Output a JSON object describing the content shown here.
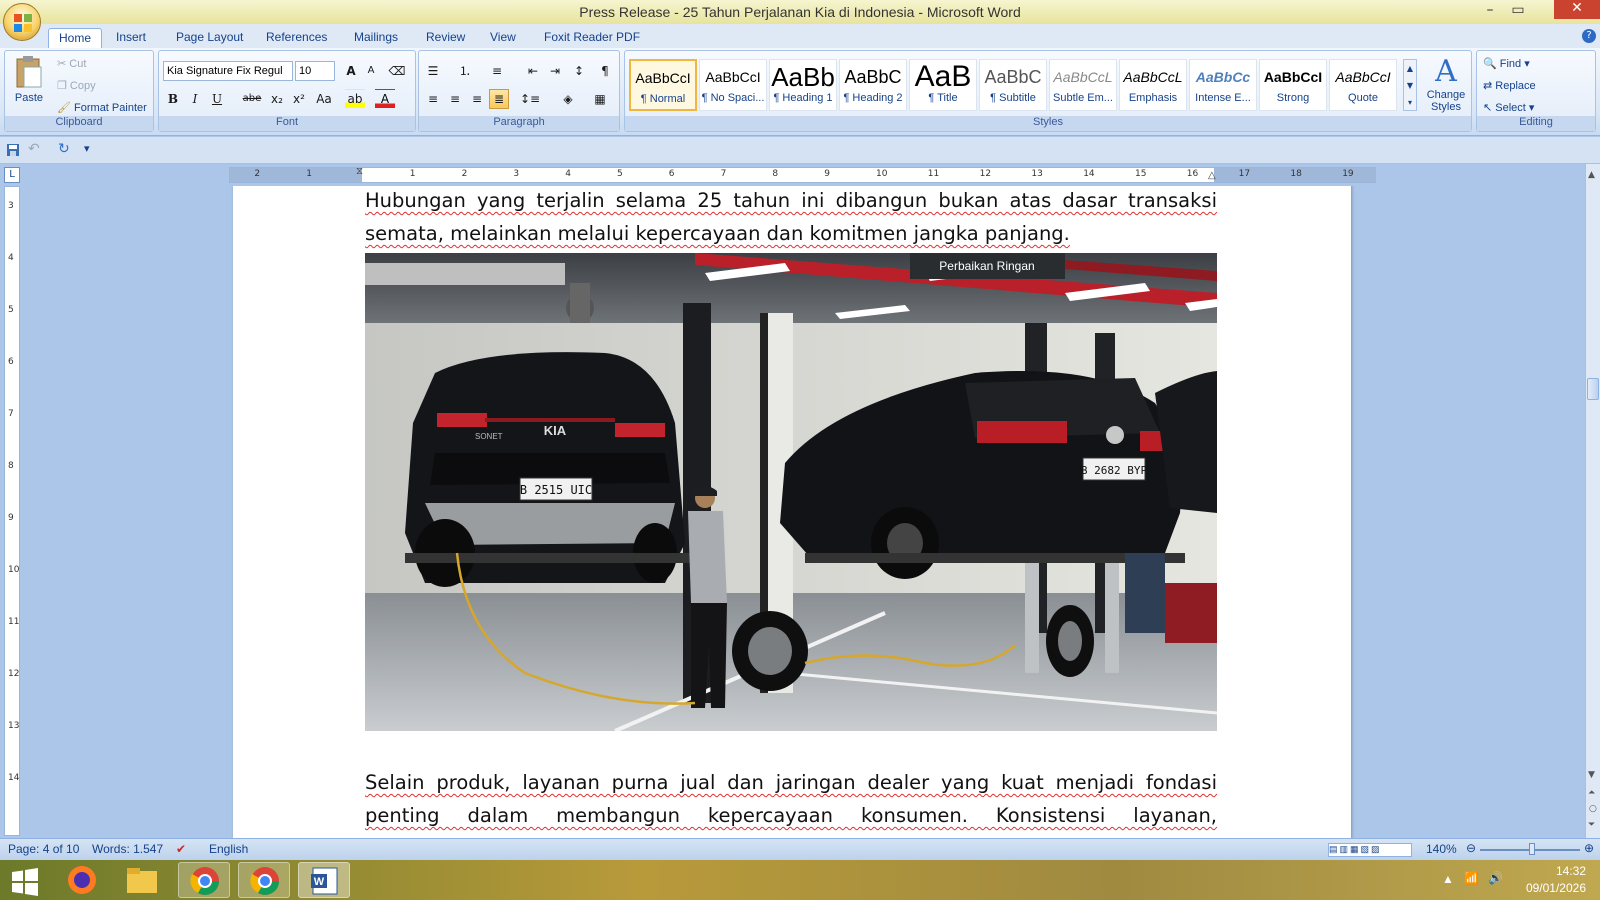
{
  "window": {
    "title": "Press Release - 25 Tahun Perjalanan Kia di Indonesia - Microsoft Word",
    "minimize": "–",
    "maximize": "▭",
    "close": "✕"
  },
  "tabs": [
    "Home",
    "Insert",
    "Page Layout",
    "References",
    "Mailings",
    "Review",
    "View",
    "Foxit Reader PDF"
  ],
  "active_tab": "Home",
  "ribbon": {
    "clipboard": {
      "label": "Clipboard",
      "paste": "Paste",
      "cut": "Cut",
      "copy": "Copy",
      "format_painter": "Format Painter"
    },
    "font": {
      "label": "Font",
      "font_name": "Kia Signature Fix Regul",
      "font_size": "10",
      "bold": "B",
      "italic": "I",
      "underline": "U",
      "strike": "abe",
      "sub": "x₂",
      "sup": "x²",
      "case": "Aa",
      "grow": "A",
      "shrink": "A"
    },
    "paragraph": {
      "label": "Paragraph",
      "pilcrow": "¶"
    },
    "styles": {
      "label": "Styles",
      "items": [
        {
          "preview": "AaBbCcI",
          "name": "¶ Normal"
        },
        {
          "preview": "AaBbCcI",
          "name": "¶ No Spaci..."
        },
        {
          "preview": "AaBb",
          "name": "¶ Heading 1"
        },
        {
          "preview": "AaBbC",
          "name": "¶ Heading 2"
        },
        {
          "preview": "AaB",
          "name": "¶ Title"
        },
        {
          "preview": "AaBbC",
          "name": "¶ Subtitle"
        },
        {
          "preview": "AaBbCcL",
          "name": "Subtle Em..."
        },
        {
          "preview": "AaBbCcL",
          "name": "Emphasis"
        },
        {
          "preview": "AaBbCc",
          "name": "Intense E..."
        },
        {
          "preview": "AaBbCcI",
          "name": "Strong"
        },
        {
          "preview": "AaBbCcI",
          "name": "Quote"
        }
      ],
      "change_styles": "Change Styles"
    },
    "editing": {
      "label": "Editing",
      "find": "Find",
      "replace": "Replace",
      "select": "Select"
    }
  },
  "ruler": {
    "h_ticks": [
      "2",
      "1",
      "1",
      "2",
      "3",
      "4",
      "5",
      "6",
      "7",
      "8",
      "9",
      "10",
      "11",
      "12",
      "13",
      "14",
      "15",
      "16",
      "17",
      "18",
      "19"
    ],
    "v_ticks": [
      "3",
      "4",
      "5",
      "6",
      "7",
      "8",
      "9",
      "10",
      "11",
      "12",
      "13",
      "14"
    ]
  },
  "document": {
    "para1": "Hubungan yang terjalin selama 25 tahun ini dibangun bukan atas dasar transaksi semata, melainkan melalui kepercayaan dan komitmen jangka panjang.",
    "photo": {
      "sign": "Perbaikan Ringan",
      "plate_left": "B 2515 UIC",
      "plate_right": "B 2682 BYP",
      "badge": "KIA",
      "model": "SONET"
    },
    "para2": "Selain produk, layanan purna jual dan jaringan dealer yang kuat menjadi fondasi penting dalam membangun kepercayaan konsumen. Konsistensi layanan, ketersediaan dukungan purna jual,"
  },
  "status": {
    "page": "Page: 4 of 10",
    "words": "Words: 1.547",
    "language": "English",
    "zoom": "140%"
  },
  "taskbar": {
    "time": "14:32",
    "date": "09/01/2026"
  },
  "colors": {
    "ribbon_blue": "#dfe9f5",
    "title_yellow": "#e8e39c",
    "spell_red": "#e03030"
  }
}
